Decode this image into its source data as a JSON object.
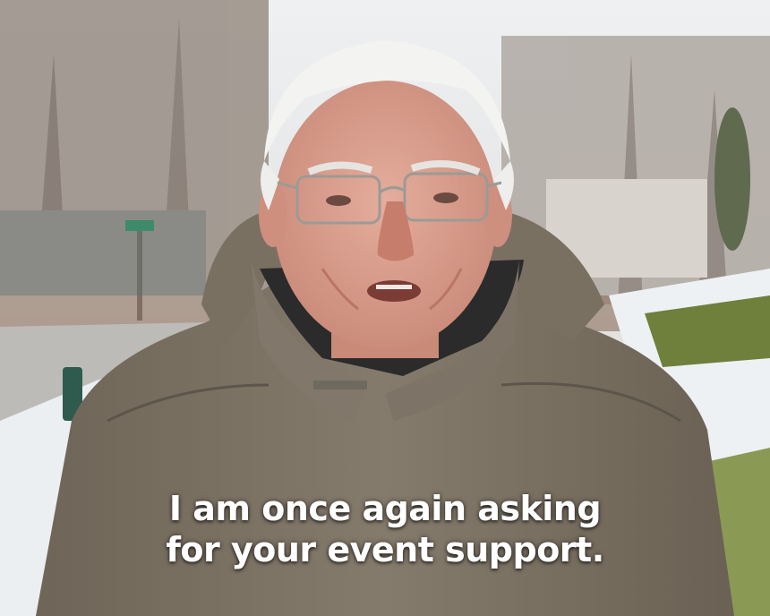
{
  "caption": {
    "line1": "I am once again asking",
    "line2": "for your event support."
  },
  "colors": {
    "sky": "#e9ecef",
    "trees": "#9b9088",
    "road": "#b9b7b3",
    "snow": "#eef1f3",
    "grass": "#7d8a4a",
    "jacket": "#7b7162",
    "jacket_shadow": "#5d554a",
    "skin": "#d9a090",
    "hair": "#f2f2f0",
    "caption_text": "#ffffff"
  }
}
